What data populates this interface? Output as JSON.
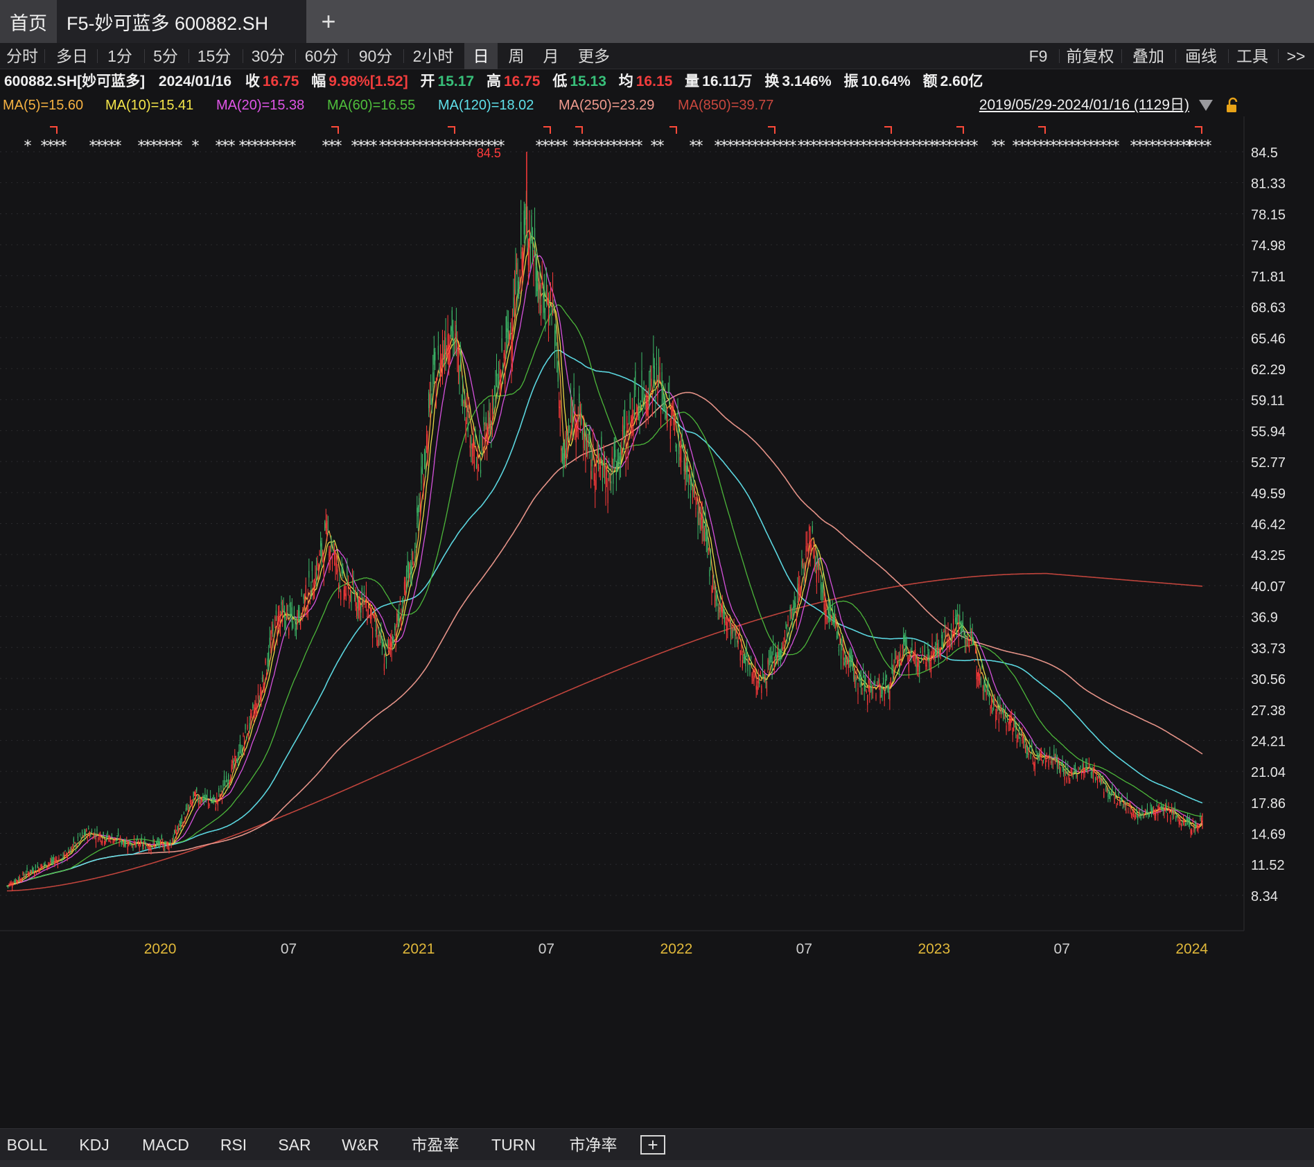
{
  "tabs": {
    "home": "首页",
    "active": "F5-妙可蓝多 600882.SH",
    "add": "+"
  },
  "periods": [
    "分时",
    "多日",
    "1分",
    "5分",
    "15分",
    "30分",
    "60分",
    "90分",
    "2小时",
    "日",
    "周",
    "月",
    "更多"
  ],
  "selected_period": "日",
  "tools": [
    "F9",
    "前复权",
    "叠加",
    "画线",
    "工具",
    ">>"
  ],
  "quote": {
    "name": "600882.SH[妙可蓝多]",
    "date": "2024/01/16",
    "close_label": "收",
    "close": "16.75",
    "change_label": "幅",
    "change": "9.98%[1.52]",
    "open_label": "开",
    "open": "15.17",
    "high_label": "高",
    "high": "16.75",
    "low_label": "低",
    "low": "15.13",
    "avg_label": "均",
    "avg": "16.15",
    "volume_label": "量",
    "volume": "16.11万",
    "turnover_label": "换",
    "turnover": "3.146%",
    "amplitude_label": "振",
    "amplitude": "10.64%",
    "amount_label": "额",
    "amount": "2.60亿"
  },
  "ma_labels": [
    {
      "text": "MA(5)=15.60",
      "color": "#f5b142"
    },
    {
      "text": "MA(10)=15.41",
      "color": "#f5e64a"
    },
    {
      "text": "MA(20)=15.38",
      "color": "#e055e8"
    },
    {
      "text": "MA(60)=16.55",
      "color": "#4fbf3c"
    },
    {
      "text": "MA(120)=18.02",
      "color": "#5fe0ea"
    },
    {
      "text": "MA(250)=23.29",
      "color": "#f09a8e"
    },
    {
      "text": "MA(850)=39.77",
      "color": "#c9473e"
    }
  ],
  "date_range": "2019/05/29-2024/01/16 (1129日)",
  "indicators": [
    "BOLL",
    "KDJ",
    "MACD",
    "RSI",
    "SAR",
    "W&R",
    "市盈率",
    "TURN",
    "市净率"
  ],
  "indicator_add": "+",
  "chart_data": {
    "type": "candlestick",
    "y_ticks": [
      "84.5",
      "81.33",
      "78.15",
      "74.98",
      "71.81",
      "68.63",
      "65.46",
      "62.29",
      "59.11",
      "55.94",
      "52.77",
      "49.59",
      "46.42",
      "43.25",
      "40.07",
      "36.9",
      "33.73",
      "30.56",
      "27.38",
      "24.21",
      "21.04",
      "17.86",
      "14.69",
      "11.52",
      "8.34"
    ],
    "ylim": [
      8.34,
      84.5
    ],
    "x_ticks": [
      "2020",
      "07",
      "2021",
      "07",
      "2022",
      "07",
      "2023",
      "07",
      "2024"
    ],
    "x_tick_dates": [
      "2020-01-01",
      "2020-07-01",
      "2021-01-01",
      "2021-07-01",
      "2022-01-01",
      "2022-07-01",
      "2023-01-01",
      "2023-07-01",
      "2024-01-01"
    ],
    "x_range": [
      "2019-05-29",
      "2024-01-16"
    ],
    "max_label": "84.5",
    "close_series": [
      [
        "2019-05-29",
        9.3
      ],
      [
        "2019-07-01",
        10.8
      ],
      [
        "2019-08-15",
        12.2
      ],
      [
        "2019-09-20",
        14.8
      ],
      [
        "2019-10-20",
        14.2
      ],
      [
        "2019-12-05",
        13.5
      ],
      [
        "2020-01-15",
        13.6
      ],
      [
        "2020-02-20",
        18.5
      ],
      [
        "2020-03-20",
        17.8
      ],
      [
        "2020-04-20",
        22.5
      ],
      [
        "2020-05-20",
        28.5
      ],
      [
        "2020-06-15",
        37.0
      ],
      [
        "2020-07-10",
        36.5
      ],
      [
        "2020-08-05",
        40.5
      ],
      [
        "2020-08-25",
        45.5
      ],
      [
        "2020-09-15",
        40.0
      ],
      [
        "2020-10-20",
        38.0
      ],
      [
        "2020-11-15",
        32.5
      ],
      [
        "2020-12-05",
        37.0
      ],
      [
        "2020-12-25",
        43.0
      ],
      [
        "2021-01-20",
        60.0
      ],
      [
        "2021-02-15",
        67.0
      ],
      [
        "2021-03-10",
        58.5
      ],
      [
        "2021-03-25",
        52.0
      ],
      [
        "2021-04-15",
        58.0
      ],
      [
        "2021-05-05",
        64.0
      ],
      [
        "2021-05-20",
        71.0
      ],
      [
        "2021-06-05",
        77.5
      ],
      [
        "2021-06-25",
        69.0
      ],
      [
        "2021-07-10",
        69.5
      ],
      [
        "2021-07-25",
        52.0
      ],
      [
        "2021-08-10",
        59.0
      ],
      [
        "2021-09-01",
        53.0
      ],
      [
        "2021-10-01",
        51.5
      ],
      [
        "2021-11-01",
        58.0
      ],
      [
        "2021-12-01",
        61.5
      ],
      [
        "2021-12-25",
        57.5
      ],
      [
        "2022-01-20",
        51.0
      ],
      [
        "2022-02-10",
        45.0
      ],
      [
        "2022-03-01",
        38.0
      ],
      [
        "2022-04-01",
        34.0
      ],
      [
        "2022-04-28",
        30.0
      ],
      [
        "2022-05-25",
        33.0
      ],
      [
        "2022-06-20",
        38.0
      ],
      [
        "2022-07-10",
        46.0
      ],
      [
        "2022-08-01",
        38.5
      ],
      [
        "2022-08-25",
        33.0
      ],
      [
        "2022-09-20",
        30.0
      ],
      [
        "2022-10-25",
        29.5
      ],
      [
        "2022-11-20",
        33.5
      ],
      [
        "2022-12-15",
        32.0
      ],
      [
        "2023-01-10",
        34.0
      ],
      [
        "2023-02-05",
        36.5
      ],
      [
        "2023-02-25",
        33.5
      ],
      [
        "2023-03-25",
        28.0
      ],
      [
        "2023-04-25",
        25.5
      ],
      [
        "2023-05-20",
        22.5
      ],
      [
        "2023-06-20",
        22.5
      ],
      [
        "2023-07-10",
        20.5
      ],
      [
        "2023-08-10",
        21.5
      ],
      [
        "2023-09-10",
        18.5
      ],
      [
        "2023-10-20",
        16.5
      ],
      [
        "2023-11-20",
        17.5
      ],
      [
        "2023-12-20",
        15.8
      ],
      [
        "2024-01-10",
        15.2
      ],
      [
        "2024-01-16",
        16.75
      ]
    ]
  }
}
